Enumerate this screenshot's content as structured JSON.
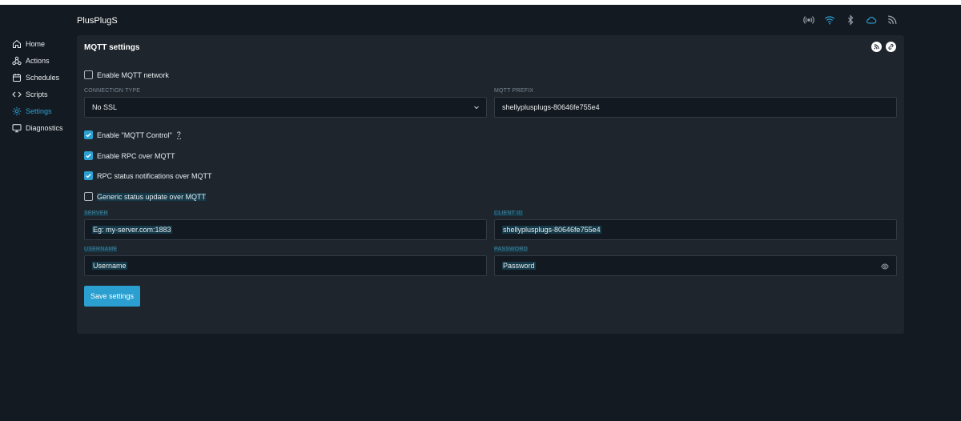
{
  "app": {
    "title": "PlusPlugS"
  },
  "status_icons": [
    "signal-icon",
    "wifi-icon",
    "bluetooth-icon",
    "cloud-icon",
    "rss-icon"
  ],
  "sidebar": {
    "items": [
      {
        "label": "Home",
        "icon": "home-icon"
      },
      {
        "label": "Actions",
        "icon": "actions-icon"
      },
      {
        "label": "Schedules",
        "icon": "calendar-icon"
      },
      {
        "label": "Scripts",
        "icon": "code-icon"
      },
      {
        "label": "Settings",
        "icon": "gear-icon",
        "active": true
      },
      {
        "label": "Diagnostics",
        "icon": "monitor-icon"
      }
    ]
  },
  "card": {
    "title": "MQTT settings",
    "enable_mqtt": {
      "label": "Enable MQTT network",
      "checked": false
    },
    "connection_type": {
      "label": "CONNECTION TYPE",
      "value": "No SSL"
    },
    "mqtt_prefix": {
      "label": "MQTT PREFIX",
      "value": "shellyplusplugs-80646fe755e4"
    },
    "enable_control": {
      "label": "Enable \"MQTT Control\"",
      "help": "?",
      "checked": true
    },
    "enable_rpc": {
      "label": "Enable RPC over MQTT",
      "checked": true
    },
    "rpc_notifications": {
      "label": "RPC status notifications over MQTT",
      "checked": true
    },
    "generic_status": {
      "label": "Generic status update over MQTT",
      "checked": false
    },
    "server": {
      "label": "SERVER",
      "placeholder": "Eg: my-server.com:1883"
    },
    "client_id": {
      "label": "CLIENT ID",
      "value": "shellyplusplugs-80646fe755e4"
    },
    "username": {
      "label": "USERNAME",
      "placeholder": "Username"
    },
    "password": {
      "label": "PASSWORD",
      "placeholder": "Password"
    },
    "save_label": "Save settings"
  },
  "colors": {
    "accent": "#2a9fd0",
    "background": "#141a21",
    "card": "#1e252d"
  }
}
